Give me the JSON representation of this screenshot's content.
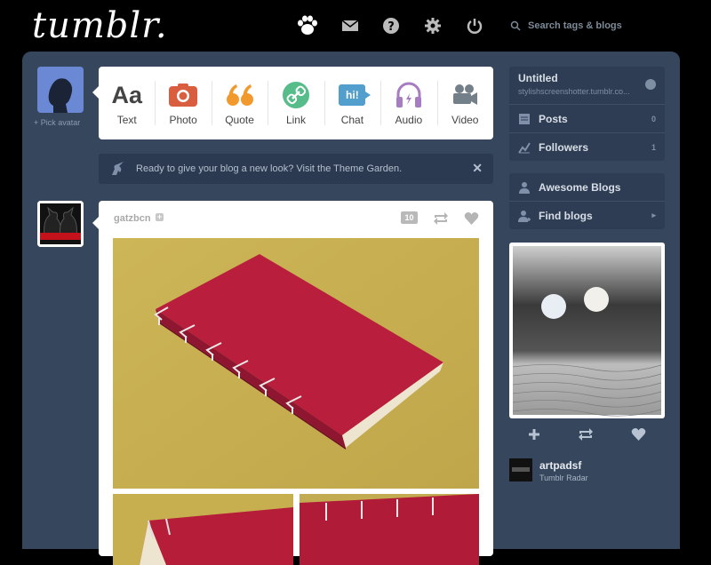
{
  "header": {
    "logo_text": "tumblr.",
    "nav_icons": [
      "paw-icon",
      "mail-icon",
      "help-icon",
      "gear-icon",
      "power-icon"
    ],
    "search_placeholder": "Search tags & blogs"
  },
  "sidebar_left": {
    "pick_avatar": "+ Pick avatar"
  },
  "post_types": [
    {
      "label": "Aa",
      "name": "Text",
      "color": "#444444"
    },
    {
      "label": "",
      "name": "Photo",
      "color": "#d95e40"
    },
    {
      "label": "",
      "name": "Quote",
      "color": "#f2992e"
    },
    {
      "label": "",
      "name": "Link",
      "color": "#56bc8a"
    },
    {
      "label": "hi!",
      "name": "Chat",
      "color": "#529ecc"
    },
    {
      "label": "",
      "name": "Audio",
      "color": "#a77dc2"
    },
    {
      "label": "",
      "name": "Video",
      "color": "#748089"
    }
  ],
  "notice": {
    "text": "Ready to give your blog a new look? Visit the Theme Garden.",
    "close": "✕"
  },
  "post": {
    "username": "gatzbcn",
    "follow": "+",
    "note_count": "10"
  },
  "blog": {
    "title": "Untitled",
    "url": "stylishscreenshotter.tumblr.co...",
    "rows": [
      {
        "label": "Posts",
        "count": "0"
      },
      {
        "label": "Followers",
        "count": "1"
      }
    ]
  },
  "links": [
    {
      "label": "Awesome Blogs"
    },
    {
      "label": "Find blogs"
    }
  ],
  "radar": {
    "blog_name": "artpadsf",
    "source": "Tumblr Radar"
  },
  "colors": {
    "dashboard_bg": "#36465d",
    "sidebar_box": "#2e3d53",
    "topbar": "#000000"
  }
}
